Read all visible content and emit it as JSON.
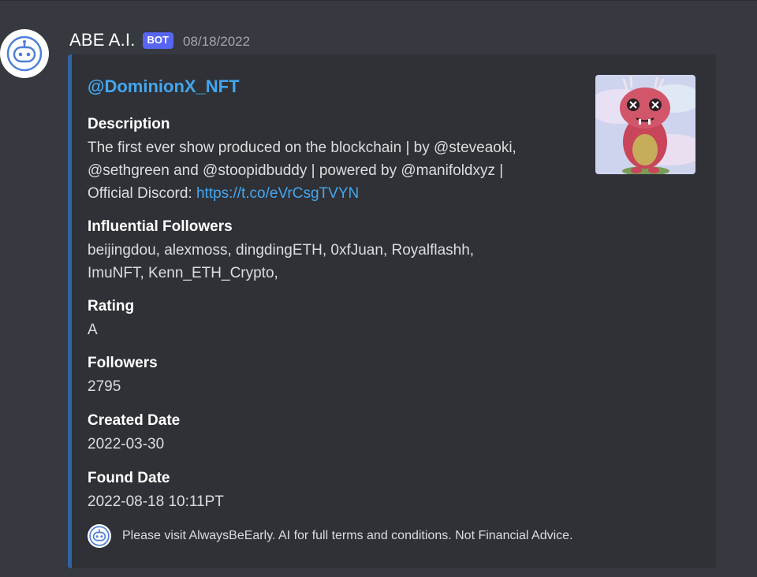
{
  "message": {
    "username": "ABE A.I.",
    "badge": "BOT",
    "timestamp": "08/18/2022",
    "avatar_icon": "robot-icon"
  },
  "embed": {
    "accent_color": "#2f64a3",
    "title": "@DominionX_NFT",
    "thumbnail_icon": "pink-monster-nft-image",
    "fields": [
      {
        "name": "Description",
        "value_text": "The first ever show produced on the blockchain | by @steveaoki,",
        "value_text_2": "@sethgreen and @stoopidbuddy | powered by @manifoldxyz |",
        "value_text_3": "Official Discord: ",
        "link": "https://t.co/eVrCsgTVYN"
      },
      {
        "name": "Influential Followers",
        "value_line1": "beijingdou, alexmoss, dingdingETH, 0xfJuan, Royalflashh,",
        "value_line2": "ImuNFT, Kenn_ETH_Crypto,"
      },
      {
        "name": "Rating",
        "value": "A"
      },
      {
        "name": "Followers",
        "value": "2795"
      },
      {
        "name": "Created Date",
        "value": "2022-03-30"
      },
      {
        "name": "Found Date",
        "value": "2022-08-18 10:11PT"
      }
    ],
    "footer": {
      "icon": "robot-icon",
      "text": "Please visit AlwaysBeEarly. AI for full terms and conditions. Not Financial Advice."
    }
  }
}
